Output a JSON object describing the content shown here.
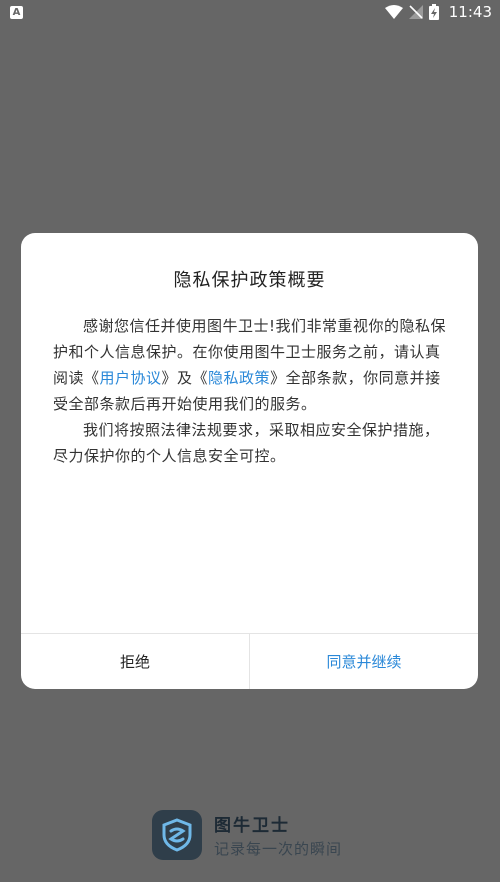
{
  "status_bar": {
    "notification_icon": "A",
    "time": "11:43"
  },
  "dialog": {
    "title": "隐私保护政策概要",
    "paragraph1": {
      "text_before_links": "感谢您信任并使用图牛卫士!我们非常重视你的隐私保护和个人信息保护。在你使用图牛卫士服务之前，请认真阅读《",
      "link_user_agreement": "用户协议",
      "between_links": "》及《",
      "link_privacy_policy": "隐私政策",
      "text_after_links": "》全部条款，你同意并接受全部条款后再开始使用我们的服务。"
    },
    "paragraph2": "我们将按照法律法规要求，采取相应安全保护措施，尽力保护你的个人信息安全可控。",
    "reject_label": "拒绝",
    "agree_label": "同意并继续"
  },
  "brand": {
    "name": "图牛卫士",
    "slogan": "记录每一次的瞬间"
  },
  "colors": {
    "accent": "#2a88d8",
    "overlay": "#666666",
    "logo_bg": "#2f3e4a",
    "logo_mark": "#6fb8e8"
  }
}
